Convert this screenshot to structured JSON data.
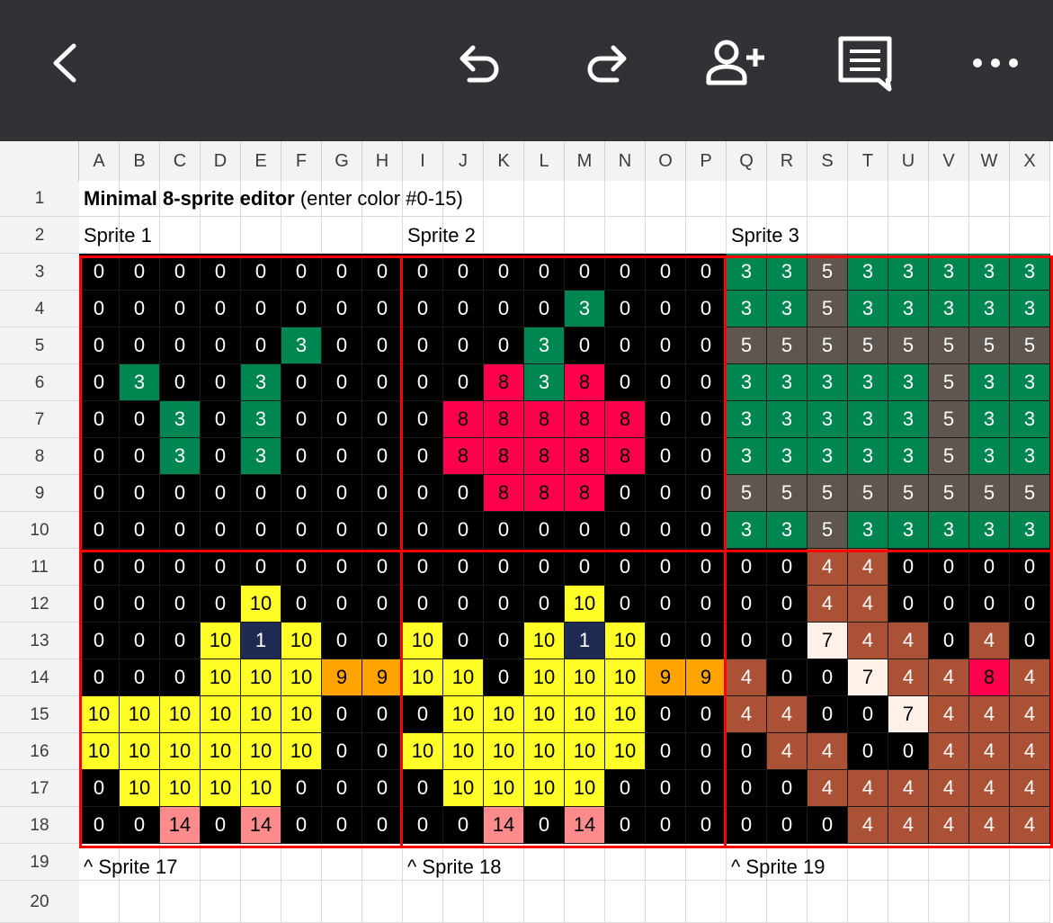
{
  "toolbar": {
    "icons": [
      "back-icon",
      "undo-icon",
      "redo-icon",
      "add-person-icon",
      "comment-icon",
      "more-icon"
    ],
    "bg": "#313235"
  },
  "columns": [
    "A",
    "B",
    "C",
    "D",
    "E",
    "F",
    "G",
    "H",
    "I",
    "J",
    "K",
    "L",
    "M",
    "N",
    "O",
    "P",
    "Q",
    "R",
    "S",
    "T",
    "U",
    "V",
    "W",
    "X"
  ],
  "rows": [
    "1",
    "2",
    "3",
    "4",
    "5",
    "6",
    "7",
    "8",
    "9",
    "10",
    "11",
    "12",
    "13",
    "14",
    "15",
    "16",
    "17",
    "18",
    "19",
    "20"
  ],
  "header": {
    "title_bold": "Minimal 8-sprite editor",
    "title_rest": "(enter color #0-15)"
  },
  "sprite_labels": [
    "Sprite 1",
    "Sprite 2",
    "Sprite 3"
  ],
  "bottom_labels": [
    "^ Sprite 17",
    "^ Sprite 18",
    "^ Sprite 19"
  ],
  "palette": {
    "0": "#000000",
    "1": "#1d2b53",
    "3": "#008751",
    "4": "#ab5236",
    "5": "#5f574f",
    "7": "#fff1e8",
    "8": "#ff004d",
    "9": "#ffa300",
    "10": "#ffff27",
    "14": "#ff8c8c"
  },
  "pixels": [
    [
      0,
      0,
      0,
      0,
      0,
      0,
      0,
      0,
      0,
      0,
      0,
      0,
      0,
      0,
      0,
      0,
      3,
      3,
      5,
      3,
      3,
      3,
      3,
      3
    ],
    [
      0,
      0,
      0,
      0,
      0,
      0,
      0,
      0,
      0,
      0,
      0,
      0,
      3,
      0,
      0,
      0,
      3,
      3,
      5,
      3,
      3,
      3,
      3,
      3
    ],
    [
      0,
      0,
      0,
      0,
      0,
      3,
      0,
      0,
      0,
      0,
      0,
      3,
      0,
      0,
      0,
      0,
      5,
      5,
      5,
      5,
      5,
      5,
      5,
      5
    ],
    [
      0,
      3,
      0,
      0,
      3,
      0,
      0,
      0,
      0,
      0,
      8,
      3,
      8,
      0,
      0,
      0,
      3,
      3,
      3,
      3,
      3,
      5,
      3,
      3
    ],
    [
      0,
      0,
      3,
      0,
      3,
      0,
      0,
      0,
      0,
      8,
      8,
      8,
      8,
      8,
      0,
      0,
      3,
      3,
      3,
      3,
      3,
      5,
      3,
      3
    ],
    [
      0,
      0,
      3,
      0,
      3,
      0,
      0,
      0,
      0,
      8,
      8,
      8,
      8,
      8,
      0,
      0,
      3,
      3,
      3,
      3,
      3,
      5,
      3,
      3
    ],
    [
      0,
      0,
      0,
      0,
      0,
      0,
      0,
      0,
      0,
      0,
      8,
      8,
      8,
      0,
      0,
      0,
      5,
      5,
      5,
      5,
      5,
      5,
      5,
      5
    ],
    [
      0,
      0,
      0,
      0,
      0,
      0,
      0,
      0,
      0,
      0,
      0,
      0,
      0,
      0,
      0,
      0,
      3,
      3,
      5,
      3,
      3,
      3,
      3,
      3
    ],
    [
      0,
      0,
      0,
      0,
      0,
      0,
      0,
      0,
      0,
      0,
      0,
      0,
      0,
      0,
      0,
      0,
      0,
      0,
      4,
      4,
      0,
      0,
      0,
      0
    ],
    [
      0,
      0,
      0,
      0,
      10,
      0,
      0,
      0,
      0,
      0,
      0,
      0,
      10,
      0,
      0,
      0,
      0,
      0,
      4,
      4,
      0,
      0,
      0,
      0
    ],
    [
      0,
      0,
      0,
      10,
      1,
      10,
      0,
      0,
      10,
      0,
      0,
      10,
      1,
      10,
      0,
      0,
      0,
      0,
      7,
      4,
      4,
      0,
      4,
      0
    ],
    [
      0,
      0,
      0,
      10,
      10,
      10,
      9,
      9,
      10,
      10,
      0,
      10,
      10,
      10,
      9,
      9,
      4,
      0,
      0,
      7,
      4,
      4,
      8,
      4
    ],
    [
      10,
      10,
      10,
      10,
      10,
      10,
      0,
      0,
      0,
      10,
      10,
      10,
      10,
      10,
      0,
      0,
      4,
      4,
      0,
      0,
      7,
      4,
      4,
      4
    ],
    [
      10,
      10,
      10,
      10,
      10,
      10,
      0,
      0,
      10,
      10,
      10,
      10,
      10,
      10,
      0,
      0,
      0,
      4,
      4,
      0,
      0,
      4,
      4,
      4
    ],
    [
      0,
      10,
      10,
      10,
      10,
      0,
      0,
      0,
      0,
      10,
      10,
      10,
      10,
      0,
      0,
      0,
      0,
      0,
      4,
      4,
      4,
      4,
      4,
      4
    ],
    [
      0,
      0,
      14,
      0,
      14,
      0,
      0,
      0,
      0,
      0,
      14,
      0,
      14,
      0,
      0,
      0,
      0,
      0,
      0,
      4,
      4,
      4,
      4,
      4
    ]
  ]
}
